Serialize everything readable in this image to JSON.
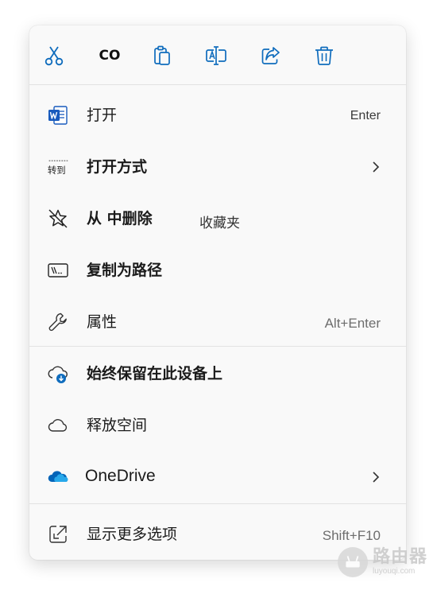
{
  "toolbar": {
    "cut": "cut-icon",
    "copy_text": "CO",
    "paste": "paste-icon",
    "rename": "rename-icon",
    "share": "share-icon",
    "delete": "trash-icon"
  },
  "menu": {
    "open": {
      "label": "打开",
      "shortcut": "Enter",
      "icon": "word-document-icon"
    },
    "open_with": {
      "label": "打开方式",
      "icon_text": "转到",
      "icon": "open-with-icon"
    },
    "remove_favorites": {
      "label": "从 中删除",
      "extra": "收藏夹",
      "icon": "unfavorite-star-icon"
    },
    "copy_path": {
      "label": "复制为路径",
      "icon": "copy-path-icon"
    },
    "properties": {
      "label": "属性",
      "shortcut": "Alt+Enter",
      "icon": "wrench-icon"
    },
    "keep_on_device": {
      "label": "始终保留在此设备上",
      "icon": "cloud-download-icon"
    },
    "free_space": {
      "label": "释放空间",
      "icon": "cloud-icon"
    },
    "onedrive": {
      "label": "OneDrive",
      "icon": "onedrive-icon"
    },
    "more_options": {
      "label": "显示更多选项",
      "shortcut": "Shift+F10",
      "icon": "open-external-icon"
    }
  },
  "watermark": {
    "cn": "路由器",
    "en": "luyouqi.com"
  },
  "colors": {
    "accent": "#0f6cbd",
    "word_blue": "#185abd",
    "onedrive_blue": "#0364b8"
  }
}
